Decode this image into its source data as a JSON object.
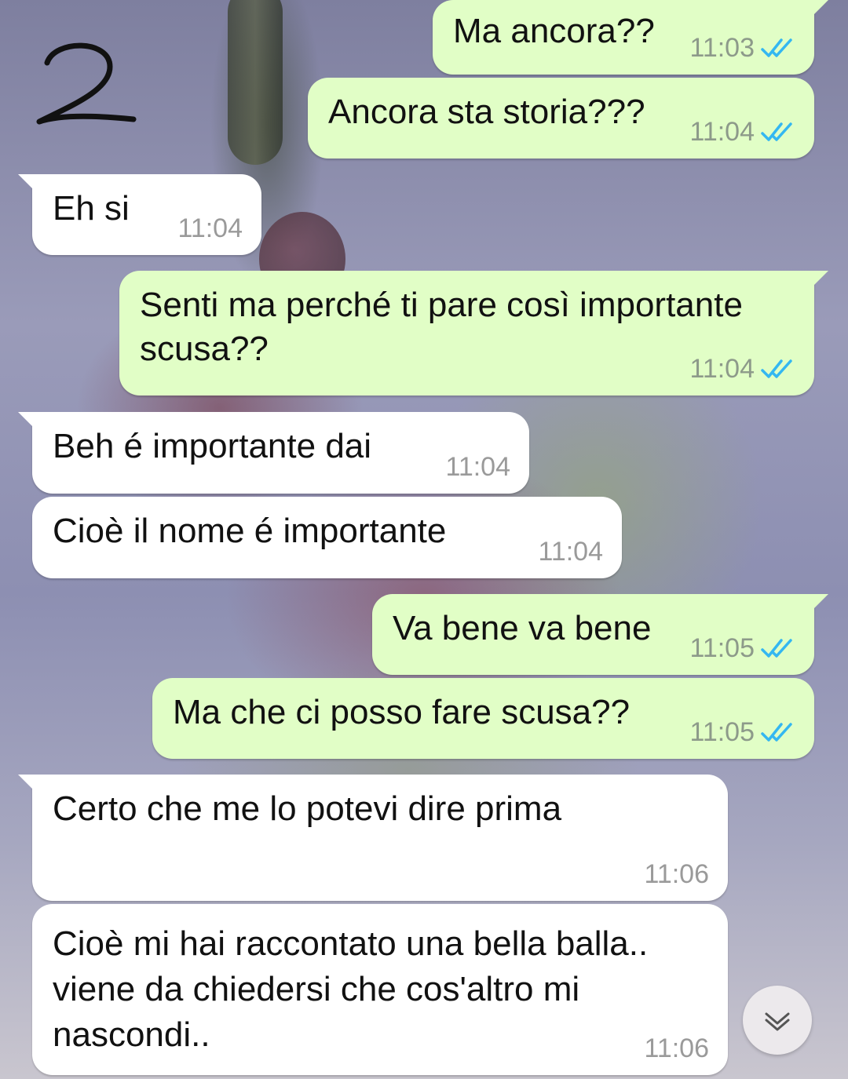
{
  "conversation": {
    "messages": [
      {
        "direction": "outgoing",
        "text": "Ma ancora??",
        "time": "11:03",
        "status": "read"
      },
      {
        "direction": "outgoing",
        "text": "Ancora sta storia???",
        "time": "11:04",
        "status": "read"
      },
      {
        "direction": "incoming",
        "text": "Eh si",
        "time": "11:04"
      },
      {
        "direction": "outgoing",
        "text": "Senti ma perché ti pare così importante scusa??",
        "time": "11:04",
        "status": "read"
      },
      {
        "direction": "incoming",
        "text": "Beh é importante dai",
        "time": "11:04"
      },
      {
        "direction": "incoming",
        "text": "Cioè il nome é importante",
        "time": "11:04"
      },
      {
        "direction": "outgoing",
        "text": "Va bene va bene",
        "time": "11:05",
        "status": "read"
      },
      {
        "direction": "outgoing",
        "text": "Ma che ci posso fare scusa??",
        "time": "11:05",
        "status": "read"
      },
      {
        "direction": "incoming",
        "text": "Certo che me lo potevi dire prima",
        "time": "11:06"
      },
      {
        "direction": "incoming",
        "text": "Cioè mi hai raccontato una bella balla.. viene da chiedersi che cos'altro mi nascondi..",
        "time": "11:06"
      }
    ]
  },
  "colors": {
    "outgoing_bubble": "#e1fec6",
    "incoming_bubble": "#ffffff",
    "read_tick": "#34b7f1"
  },
  "icons": {
    "read_receipt": "double-check-icon",
    "scroll_down": "chevron-down-icon",
    "overlay_mark": "handwritten-number-mark"
  }
}
